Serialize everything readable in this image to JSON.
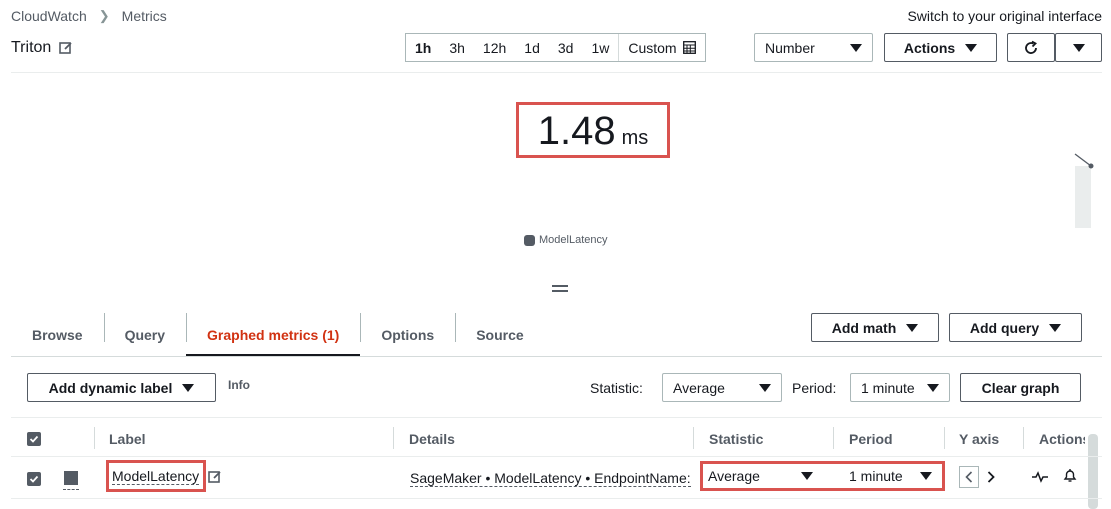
{
  "breadcrumb": {
    "root": "CloudWatch",
    "current": "Metrics"
  },
  "switch_link": "Switch to your original interface",
  "dashboard": {
    "title": "Triton"
  },
  "time_ranges": [
    "1h",
    "3h",
    "12h",
    "1d",
    "3d",
    "1w"
  ],
  "selected_time_range": "1h",
  "custom_label": "Custom",
  "visualization_type": "Number",
  "actions_label": "Actions",
  "metric_value": {
    "value": "1.48",
    "unit": "ms"
  },
  "legend": {
    "label": "ModelLatency",
    "color": "#545b64"
  },
  "tabs": [
    {
      "label": "Browse",
      "active": false
    },
    {
      "label": "Query",
      "active": false
    },
    {
      "label": "Graphed metrics (1)",
      "active": true
    },
    {
      "label": "Options",
      "active": false
    },
    {
      "label": "Source",
      "active": false
    }
  ],
  "add_math_label": "Add math",
  "add_query_label": "Add query",
  "toolbar": {
    "dynamic_label": "Add dynamic label",
    "info": "Info",
    "statistic_label": "Statistic:",
    "statistic_value": "Average",
    "period_label": "Period:",
    "period_value": "1 minute",
    "clear_graph": "Clear graph"
  },
  "table": {
    "headers": {
      "label": "Label",
      "details": "Details",
      "statistic": "Statistic",
      "period": "Period",
      "y_axis": "Y axis",
      "actions": "Actions"
    },
    "rows": [
      {
        "label": "ModelLatency",
        "details": "SageMaker • ModelLatency • EndpointName:",
        "statistic": "Average",
        "period": "1 minute",
        "checked": true,
        "color": "#545b64"
      }
    ]
  },
  "colors": {
    "accent_red": "#d13212",
    "highlight": "#d9534f"
  }
}
